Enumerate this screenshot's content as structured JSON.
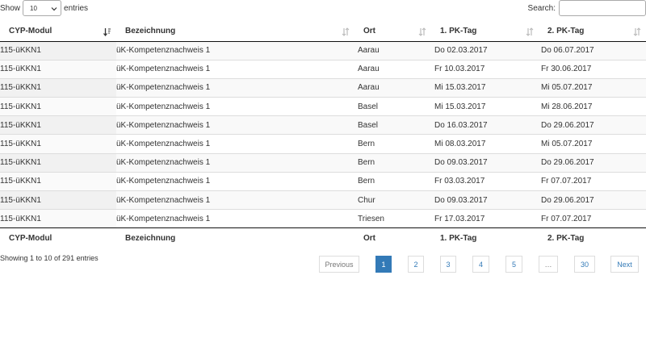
{
  "length_control": {
    "show_label": "Show",
    "selected": "10",
    "entries_label": "entries"
  },
  "search": {
    "label": "Search:",
    "value": ""
  },
  "table": {
    "columns": [
      "CYP-Modul",
      "Bezeichnung",
      "Ort",
      "1. PK-Tag",
      "2. PK-Tag"
    ],
    "sorted_column": "CYP-Modul",
    "sort_direction": "ascending",
    "rows": [
      [
        "115-üKKN1",
        "üK-Kompetenznachweis 1",
        "Aarau",
        "Do 02.03.2017",
        "Do 06.07.2017"
      ],
      [
        "115-üKKN1",
        "üK-Kompetenznachweis 1",
        "Aarau",
        "Fr 10.03.2017",
        "Fr 30.06.2017"
      ],
      [
        "115-üKKN1",
        "üK-Kompetenznachweis 1",
        "Aarau",
        "Mi 15.03.2017",
        "Mi 05.07.2017"
      ],
      [
        "115-üKKN1",
        "üK-Kompetenznachweis 1",
        "Basel",
        "Mi 15.03.2017",
        "Mi 28.06.2017"
      ],
      [
        "115-üKKN1",
        "üK-Kompetenznachweis 1",
        "Basel",
        "Do 16.03.2017",
        "Do 29.06.2017"
      ],
      [
        "115-üKKN1",
        "üK-Kompetenznachweis 1",
        "Bern",
        "Mi 08.03.2017",
        "Mi 05.07.2017"
      ],
      [
        "115-üKKN1",
        "üK-Kompetenznachweis 1",
        "Bern",
        "Do 09.03.2017",
        "Do 29.06.2017"
      ],
      [
        "115-üKKN1",
        "üK-Kompetenznachweis 1",
        "Bern",
        "Fr 03.03.2017",
        "Fr 07.07.2017"
      ],
      [
        "115-üKKN1",
        "üK-Kompetenznachweis 1",
        "Chur",
        "Do 09.03.2017",
        "Do 29.06.2017"
      ],
      [
        "115-üKKN1",
        "üK-Kompetenznachweis 1",
        "Triesen",
        "Fr 17.03.2017",
        "Fr 07.07.2017"
      ]
    ]
  },
  "info": "Showing 1 to 10 of 291 entries",
  "pagination": {
    "previous": "Previous",
    "pages": [
      "1",
      "2",
      "3",
      "4",
      "5",
      "…",
      "30"
    ],
    "current": "1",
    "next": "Next"
  },
  "colors": {
    "accent": "#337ab7",
    "border": "#dddddd",
    "text": "#333333"
  }
}
